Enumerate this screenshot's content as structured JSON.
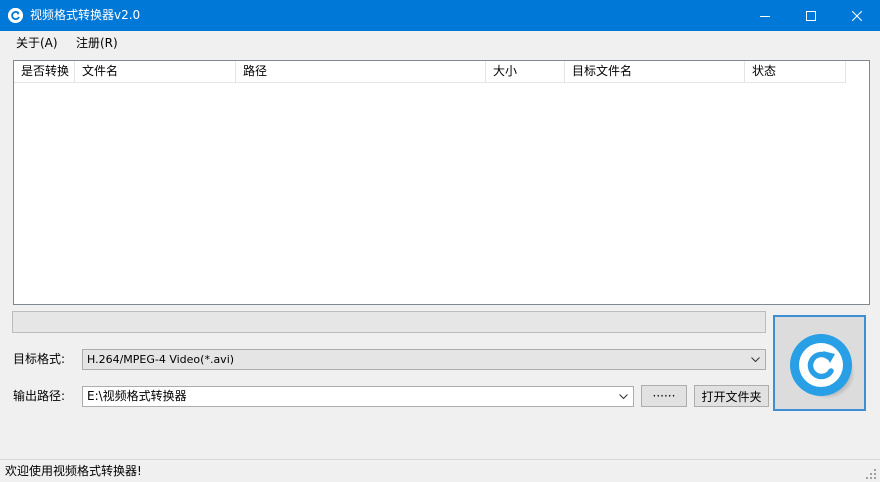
{
  "window": {
    "title": "视频格式转换器v2.0",
    "icon": "app-convert-icon",
    "accent": "#0078d7"
  },
  "menu": {
    "items": [
      {
        "label": "关于(A)"
      },
      {
        "label": "注册(R)"
      }
    ]
  },
  "file_list": {
    "columns": [
      "是否转换",
      "文件名",
      "路径",
      "大小",
      "目标文件名",
      "状态"
    ],
    "rows": []
  },
  "progress": {
    "value": 0
  },
  "form": {
    "target_format_label": "目标格式:",
    "target_format_value": "H.264/MPEG-4 Video(*.avi)",
    "output_path_label": "输出路径:",
    "output_path_value": "E:\\视频格式转换器",
    "browse_label": "······",
    "open_folder_label": "打开文件夹"
  },
  "convert_button": {
    "icon": "refresh-convert-icon",
    "color": "#29a0e6"
  },
  "status": {
    "text": "欢迎使用视频格式转换器!"
  }
}
